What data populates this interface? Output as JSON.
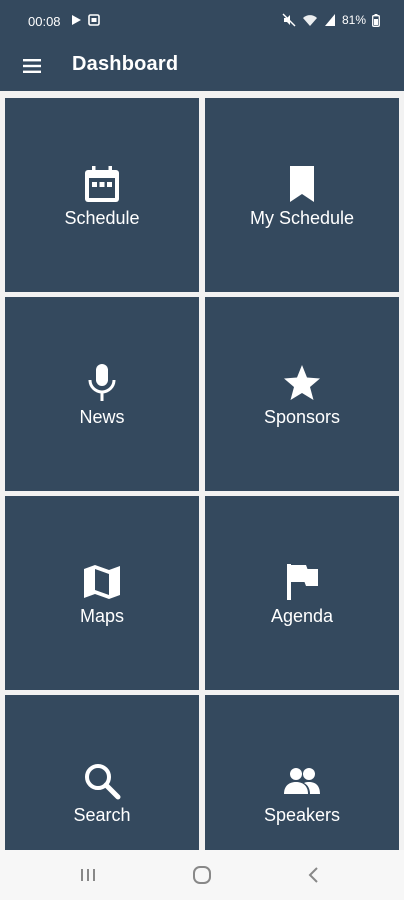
{
  "status_bar": {
    "time": "00:08",
    "battery": "81%"
  },
  "app_bar": {
    "title": "Dashboard",
    "menu_icon": "hamburger-menu-icon"
  },
  "tiles": [
    {
      "label": "Schedule",
      "icon": "calendar-icon"
    },
    {
      "label": "My Schedule",
      "icon": "bookmark-icon"
    },
    {
      "label": "News",
      "icon": "microphone-icon"
    },
    {
      "label": "Sponsors",
      "icon": "star-icon"
    },
    {
      "label": "Maps",
      "icon": "map-icon"
    },
    {
      "label": "Agenda",
      "icon": "flag-icon"
    },
    {
      "label": "Search",
      "icon": "search-icon"
    },
    {
      "label": "Speakers",
      "icon": "people-icon"
    }
  ],
  "colors": {
    "primary": "#34495e",
    "background": "#f2f2f2",
    "text": "#ffffff"
  }
}
